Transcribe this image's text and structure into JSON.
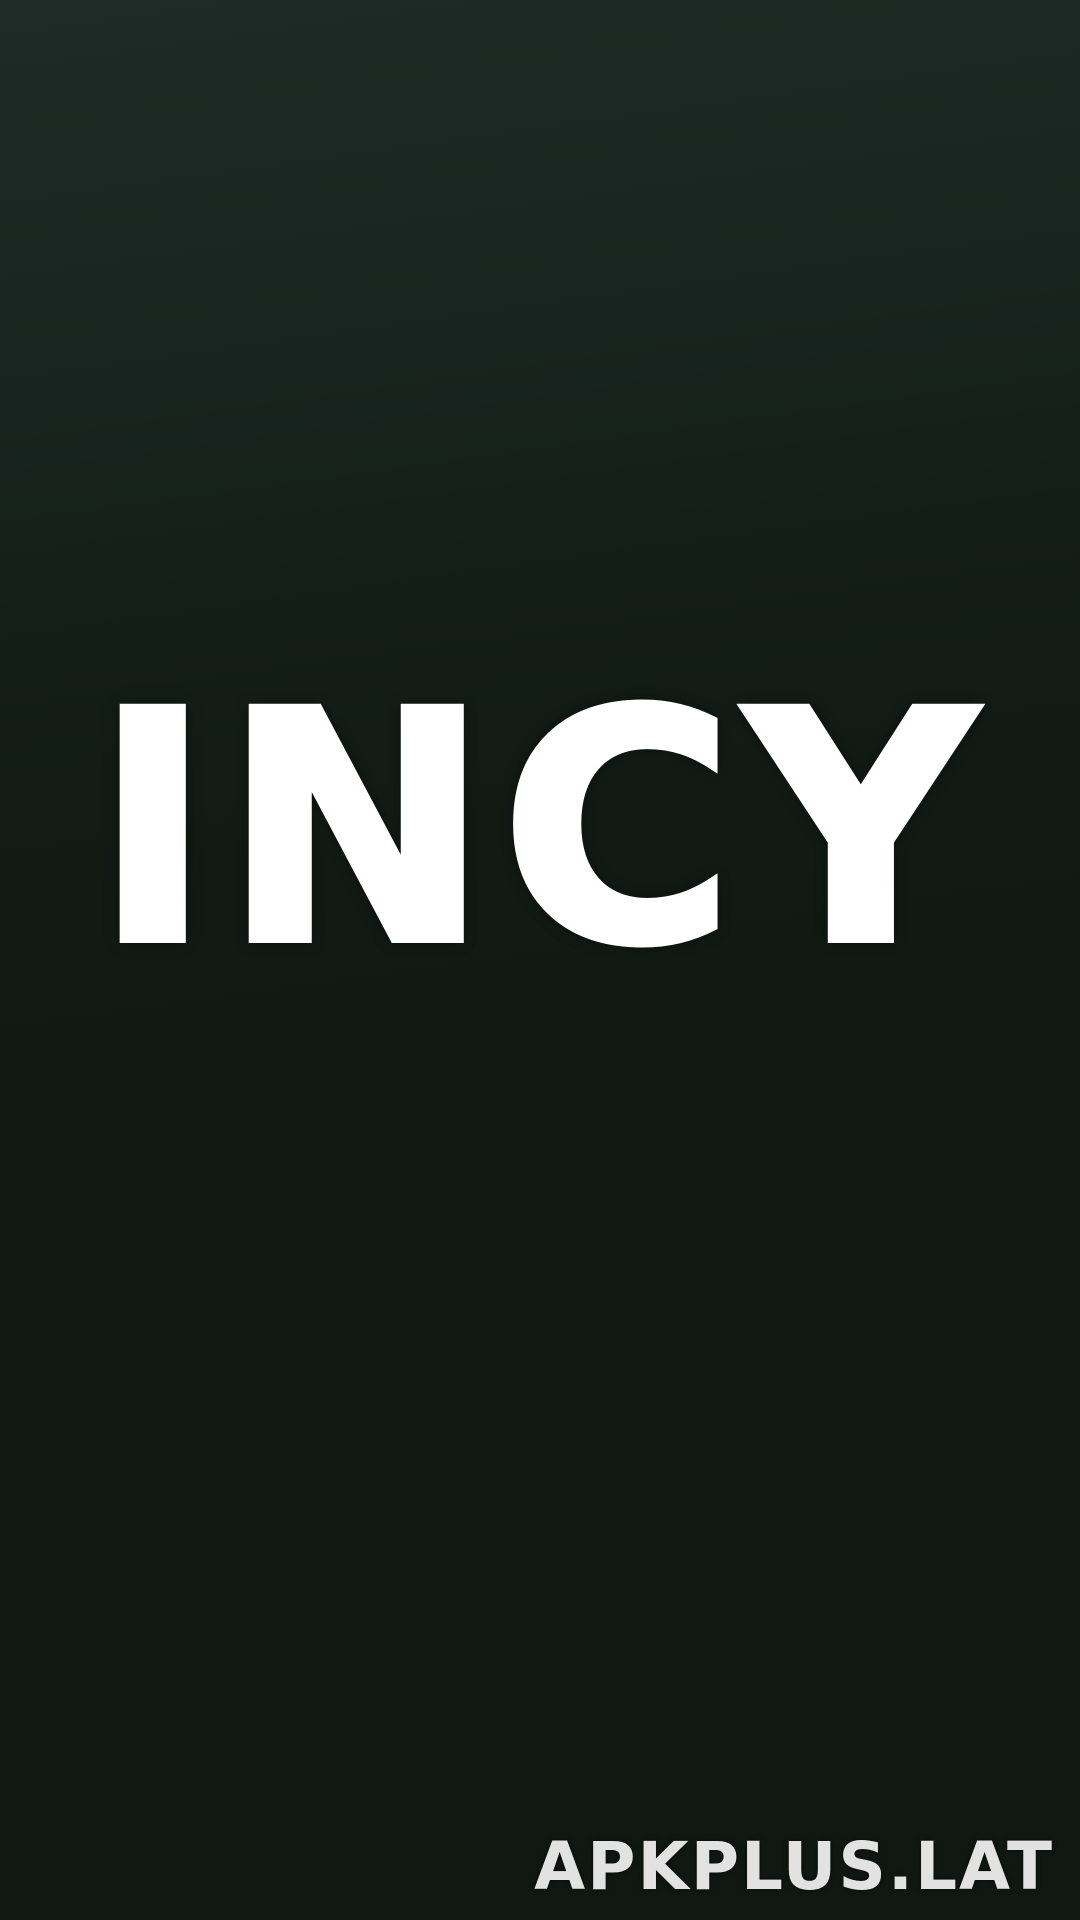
{
  "splash": {
    "logo_text": "INCY",
    "watermark": "APKPLUS.LAT"
  },
  "colors": {
    "background_top": "#1d2c27",
    "background_bottom": "#111813",
    "logo": "#ffffff",
    "watermark": "#e2e2e2"
  }
}
